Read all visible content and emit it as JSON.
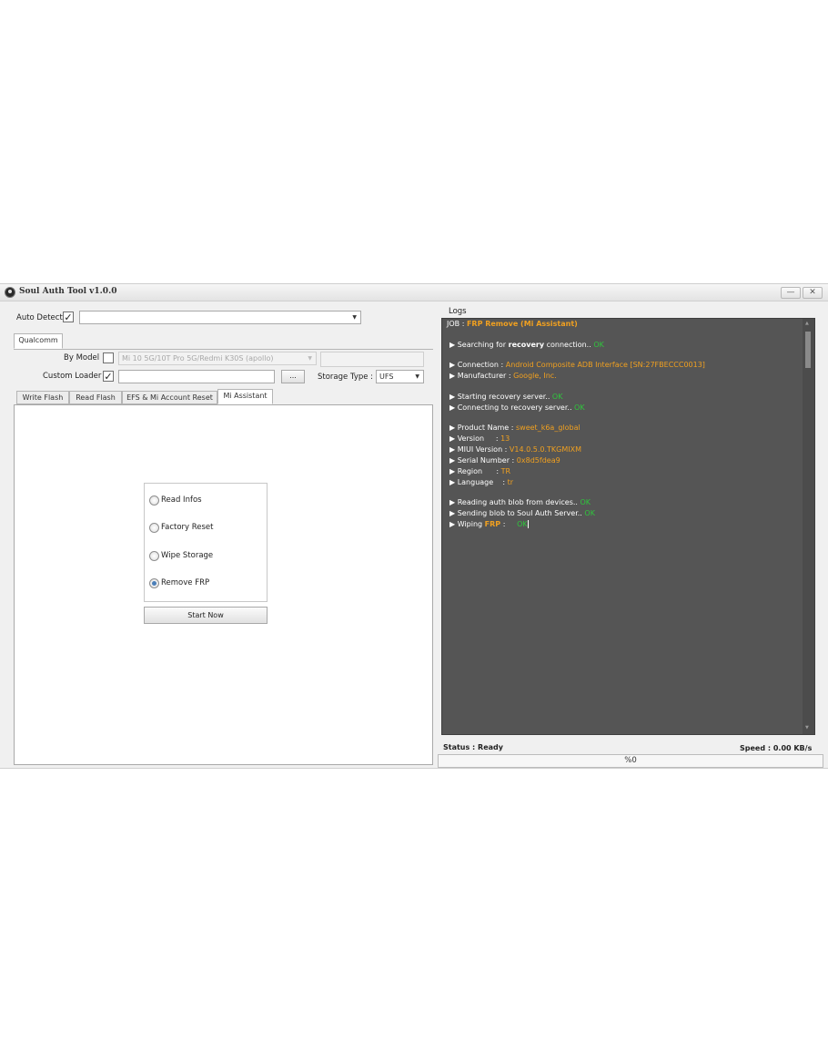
{
  "window": {
    "title": "Soul Auth Tool v1.0.0",
    "minimize": "—",
    "close": "✕"
  },
  "top": {
    "auto_detect_label": "Auto Detect",
    "auto_detect_checked": "✓",
    "device_value": ""
  },
  "platform_tab": "Qualcomm",
  "model": {
    "by_model_label": "By Model",
    "model_value": "Mi 10 5G/10T Pro 5G/Redmi K30S (apollo)",
    "extra_value": ""
  },
  "loader": {
    "custom_loader_label": "Custom Loader",
    "custom_loader_checked": "✓",
    "path_value": "",
    "browse_label": "...",
    "storage_type_label": "Storage Type :",
    "storage_type_value": "UFS"
  },
  "tabs": [
    "Write Flash",
    "Read Flash",
    "EFS & Mi Account Reset",
    "Mi Assistant"
  ],
  "active_tab": "Mi Assistant",
  "options": [
    {
      "label": "Read Infos",
      "checked": false
    },
    {
      "label": "Factory Reset",
      "checked": false
    },
    {
      "label": "Wipe Storage",
      "checked": false
    },
    {
      "label": "Remove FRP",
      "checked": true
    }
  ],
  "start_button": "Start Now",
  "logs": {
    "title": "Logs",
    "job_prefix": "JOB : ",
    "job_name": "FRP Remove (Mi Assistant)",
    "searching_prefix": "▶ Searching for ",
    "searching_mode": "recovery",
    "searching_suffix": " connection.. ",
    "ok": "OK",
    "connection_label": "▶ Connection : ",
    "connection_value": "Android Composite ADB Interface [SN:27FBECCC0013]",
    "manufacturer_label": "▶ Manufacturer : ",
    "manufacturer_value": "Google, Inc.",
    "starting_server": "▶ Starting recovery server.. ",
    "connecting_server": "▶ Connecting to recovery server.. ",
    "product_label": "▶ Product Name : ",
    "product_value": "sweet_k6a_global",
    "version_label": "▶ Version     : ",
    "version_value": "13",
    "miui_label": "▶ MIUI Version : ",
    "miui_value": "V14.0.5.0.TKGMIXM",
    "serial_label": "▶ Serial Number : ",
    "serial_value": "0x8d5fdea9",
    "region_label": "▶ Region      : ",
    "region_value": "TR",
    "language_label": "▶ Language    : ",
    "language_value": "tr",
    "reading_blob": "▶ Reading auth blob from devices.. ",
    "sending_blob": "▶ Sending blob to Soul Auth Server.. ",
    "wiping_prefix": "▶ Wiping ",
    "wiping_target": "FRP",
    "wiping_sep": " :     "
  },
  "status": {
    "status_text": "Status : Ready",
    "speed_text": "Speed : 0.00 KB/s",
    "progress_text": "%0",
    "progress": 0
  },
  "colors": {
    "log_bg": "#555555",
    "log_orange": "#f0a020",
    "log_green": "#2fc63c"
  }
}
